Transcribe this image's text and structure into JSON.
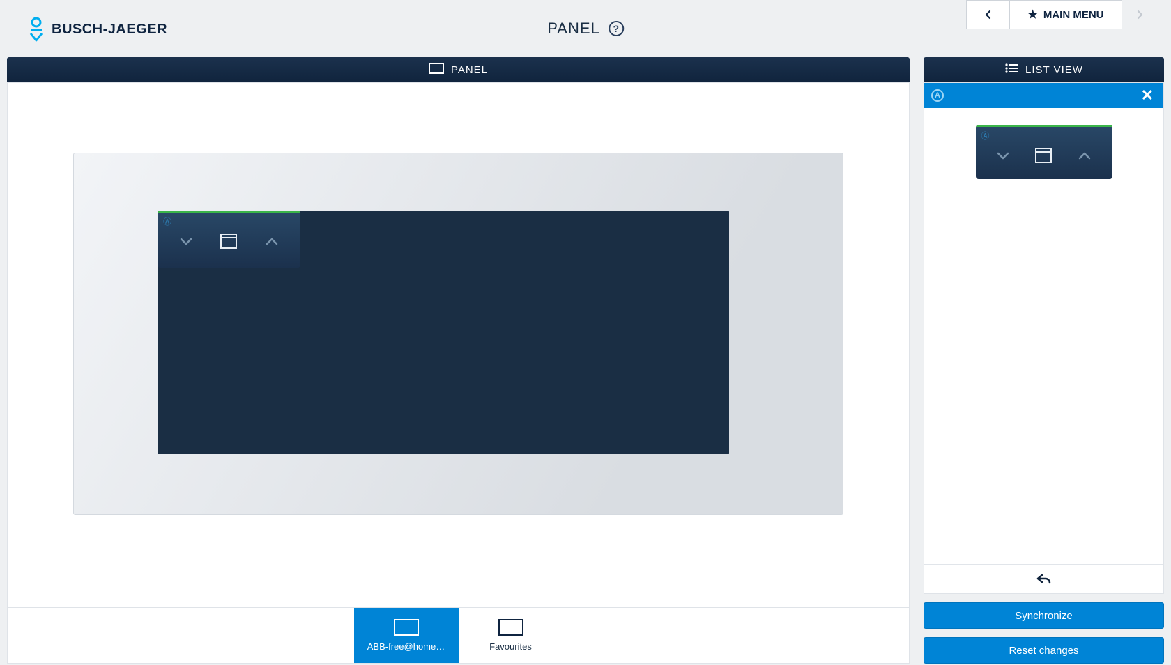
{
  "brand": {
    "name": "BUSCH-JAEGER"
  },
  "page": {
    "title": "PANEL"
  },
  "nav": {
    "main_menu_label": "MAIN MENU"
  },
  "panel": {
    "header_label": "PANEL",
    "widget": {
      "badge": "Ⓐ"
    },
    "tabs": [
      {
        "label": "ABB-free@home…",
        "active": true
      },
      {
        "label": "Favourites",
        "active": false
      }
    ]
  },
  "sidebar": {
    "header_label": "LIST VIEW",
    "widget": {
      "badge": "Ⓐ"
    },
    "indicator": {
      "letter": "A"
    },
    "actions": {
      "synchronize_label": "Synchronize",
      "reset_label": "Reset changes"
    }
  }
}
